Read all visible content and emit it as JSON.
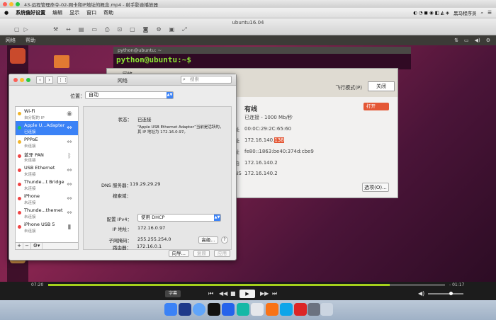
{
  "player_title": "43-远程管理命令-02-网卡和IP地址的概念.mp4 - 射手影音播放器",
  "mac_menubar": {
    "app_name": "系统偏好设置",
    "menus": [
      "编辑",
      "显示",
      "窗口",
      "帮助"
    ],
    "right_text": "黑马程序员"
  },
  "vm_title": "ubuntu16.04",
  "ubuntu_topbar": {
    "menus": [
      "网络",
      "帮助"
    ]
  },
  "terminal": {
    "title": "python@ubuntu: ~",
    "prompt": "python@ubuntu:~$"
  },
  "ubuntu_network": {
    "title": "网络",
    "airplane_label": "飞行模式(P)",
    "airplane_state": "关闭",
    "wired_title": "有线",
    "wired_state": "打开",
    "status": "已连接 - 1000 Mb/秒",
    "rows": [
      {
        "label": "址",
        "value": "00:0C:29:2C:65:60"
      },
      {
        "label": "址",
        "value": "172.16.140.",
        "highlight": "138"
      },
      {
        "label": "址",
        "value": "fe80::1863:be40:374d:cbe9"
      },
      {
        "label": "由",
        "value": "172.16.140.2"
      },
      {
        "label": "NS",
        "value": "172.16.140.2"
      }
    ],
    "options_button": "选项(O)..."
  },
  "mac_network": {
    "title": "网络",
    "search_placeholder": "搜索",
    "location_label": "位置：",
    "location_value": "自动",
    "services": [
      {
        "name": "Wi-Fi",
        "status": "自分配的 IP",
        "color": "#f0b429",
        "icon": "wifi-icon",
        "glyph": "◉"
      },
      {
        "name": "Apple U...Adapter",
        "status": "已连接",
        "color": "#22c55e",
        "icon": "ethernet-icon",
        "glyph": "⇔",
        "selected": true
      },
      {
        "name": "PPPoE",
        "status": "未连接",
        "color": "#f0b429",
        "icon": "ethernet-icon",
        "glyph": "⇔"
      },
      {
        "name": "蓝牙 PAN",
        "status": "未连接",
        "color": "#ef4444",
        "icon": "bluetooth-icon",
        "glyph": "ᛒ"
      },
      {
        "name": "USB Ethernet",
        "status": "未连接",
        "color": "#ef4444",
        "icon": "ethernet-icon",
        "glyph": "⇔"
      },
      {
        "name": "Thunde...t Bridge",
        "status": "未连接",
        "color": "#ef4444",
        "icon": "ethernet-icon",
        "glyph": "⇔"
      },
      {
        "name": "iPhone",
        "status": "未连接",
        "color": "#ef4444",
        "icon": "ethernet-icon",
        "glyph": "⇔"
      },
      {
        "name": "Thunde...thernet",
        "status": "未连接",
        "color": "#ef4444",
        "icon": "ethernet-icon",
        "glyph": "⇔"
      },
      {
        "name": "iPhone USB 5",
        "status": "未连接",
        "color": "#ef4444",
        "icon": "phone-icon",
        "glyph": "▮"
      }
    ],
    "list_controls": [
      "+",
      "−",
      "⚙▾"
    ],
    "status_label": "状态：",
    "status_value": "已连接",
    "status_desc_1": "“Apple USB Ethernet Adapter”当前是活跃的，",
    "status_desc_2": "其 IP 地址为 172.16.0.97。",
    "config_label": "配置 IPv4：",
    "config_value": "使用 DHCP",
    "ip_label": "IP 地址：",
    "ip_value": "172.16.0.97",
    "mask_label": "子网掩码：",
    "mask_value": "255.255.254.0",
    "router_label": "路由器：",
    "router_value": "172.16.0.1",
    "dns_label": "DNS 服务器：",
    "dns_value": "119.29.29.29",
    "search_domain_label": "搜索域：",
    "advanced_button": "高级...",
    "help_button": "?",
    "wizard_button": "向导...",
    "revert_button": "复原",
    "apply_button": "应用"
  },
  "player": {
    "time_elapsed": "07:20",
    "time_remaining": "- 01:17",
    "progress_fraction": 0.86,
    "volume_fraction": 0.6,
    "subtitle_button": "字幕"
  }
}
